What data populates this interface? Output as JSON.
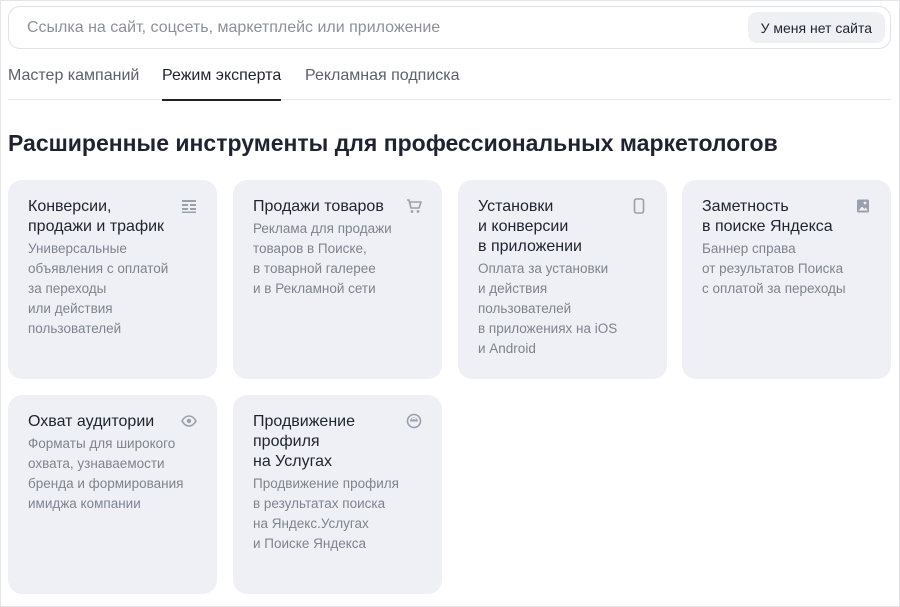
{
  "url_bar": {
    "placeholder": "Ссылка на сайт, соцсеть, маркетплейс или приложение",
    "no_site_label": "У меня нет сайта"
  },
  "tabs": [
    {
      "label": "Мастер кампаний",
      "active": false
    },
    {
      "label": "Режим эксперта",
      "active": true
    },
    {
      "label": "Рекламная подписка",
      "active": false
    }
  ],
  "headline": "Расширенные инструменты для профессиональных маркетологов",
  "cards": [
    {
      "title": "Конверсии,\nпродажи и трафик",
      "desc": "Универсальные\nобъявления с оплатой\nза переходы\nили действия\nпользователей",
      "icon": "list-icon"
    },
    {
      "title": "Продажи товаров",
      "desc": "Реклама для продажи\nтоваров в Поиске,\nв товарной галерее\nи в Рекламной сети",
      "icon": "cart-icon"
    },
    {
      "title": "Установки\nи конверсии\nв приложении",
      "desc": "Оплата за установки\nи действия\nпользователей\nв приложениях на iOS\nи Android",
      "icon": "phone-icon"
    },
    {
      "title": "Заметность\nв поиске Яндекса",
      "desc": "Баннер справа\nот результатов Поиска\nс оплатой за переходы",
      "icon": "image-icon"
    },
    {
      "title": "Охват аудитории",
      "desc": "Форматы для широкого\nохвата, узнаваемости\nбренда и формирования\nимиджа компании",
      "icon": "eye-icon"
    },
    {
      "title": "Продвижение\nпрофиля\nна Услугах",
      "desc": "Продвижение профиля\nв результатах поиска\nна Яндекс.Услугах\nи Поиске Яндекса",
      "icon": "services-icon"
    }
  ],
  "colors": {
    "card_bg": "#eef0f5",
    "text_primary": "#1f2330",
    "text_secondary": "#7f838e",
    "icon": "#9aa0ab"
  }
}
